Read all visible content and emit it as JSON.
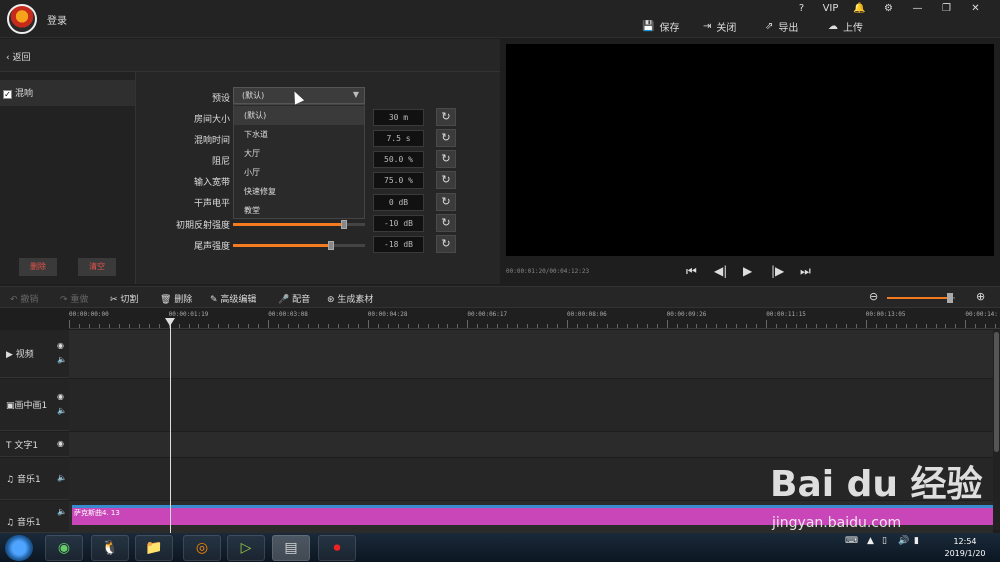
{
  "header": {
    "login": "登录"
  },
  "window_controls": [
    "?",
    "VIP",
    "🔔",
    "⚙",
    "—",
    "❐",
    "✕"
  ],
  "toolbar": {
    "save": "保存",
    "close": "关闭",
    "export": "导出",
    "upload": "上传"
  },
  "panel": {
    "back": "返回",
    "effect_item": "混响",
    "delete_btn": "删除",
    "clear_btn": "清空"
  },
  "params": {
    "preset_label": "预设",
    "preset_value": "(默认)",
    "room_size": {
      "label": "房间大小",
      "value": "30 m"
    },
    "reverb_time": {
      "label": "混响时间",
      "value": "7.5 s"
    },
    "damping": {
      "label": "阻尼",
      "value": "50.0 %"
    },
    "input_bandwidth": {
      "label": "输入宽带",
      "value": "75.0 %"
    },
    "dry_level": {
      "label": "干声电平",
      "value": "0 dB"
    },
    "early_reflection": {
      "label": "初期反射强度",
      "value": "-10 dB",
      "fraction": 0.84
    },
    "tail_level": {
      "label": "尾声强度",
      "value": "-18 dB",
      "fraction": 0.74
    }
  },
  "dropdown": [
    "(默认)",
    "下水道",
    "大厅",
    "小厅",
    "快速修复",
    "教堂"
  ],
  "preview": {
    "timecode": "00:00:01:20/00:04:12:23"
  },
  "edit_toolbar": {
    "undo": "撤销",
    "redo": "重做",
    "cut": "切割",
    "delete": "删除",
    "advanced": "高级编辑",
    "dub": "配音",
    "gen_material": "生成素材"
  },
  "ruler": [
    "00:00:00:00",
    "00:00:01:19",
    "00:00:03:08",
    "00:00:04:28",
    "00:00:06:17",
    "00:00:08:06",
    "00:00:09:26",
    "00:00:11:15",
    "00:00:13:05",
    "00:00:14:"
  ],
  "tracks": {
    "video": "视频",
    "pip": "画中画1",
    "text": "文字1",
    "music1": "音乐1",
    "music2": "音乐1"
  },
  "clip": {
    "label": "萨克斯曲4. 13"
  },
  "taskbar": {
    "time": "12:54",
    "date": "2019/1/20"
  },
  "watermark": {
    "main": "Bai du 经验",
    "sub": "jingyan.baidu.com"
  }
}
